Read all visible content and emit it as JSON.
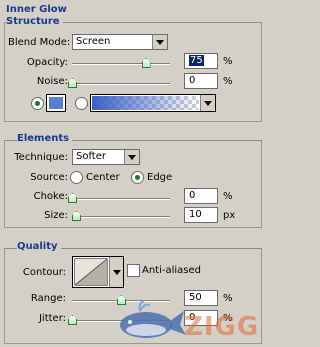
{
  "panel_title": "Inner Glow",
  "structure": {
    "title": "Structure",
    "blend_mode_label": "Blend Mode:",
    "blend_mode_value": "Screen",
    "opacity_label": "Opacity:",
    "opacity_value": "75",
    "opacity_unit": "%",
    "opacity_level": 0.75,
    "noise_label": "Noise:",
    "noise_value": "0",
    "noise_unit": "%",
    "noise_level": 0.0,
    "color_swatch": "#5b7fd0",
    "gradient_from": "#3a5fc8",
    "gradient_to": "#ffffff"
  },
  "elements": {
    "title": "Elements",
    "technique_label": "Technique:",
    "technique_value": "Softer",
    "source_label": "Source:",
    "source_center": "Center",
    "source_edge": "Edge",
    "choke_label": "Choke:",
    "choke_value": "0",
    "choke_unit": "%",
    "choke_level": 0.0,
    "size_label": "Size:",
    "size_value": "10",
    "size_unit": "px",
    "size_level": 0.04
  },
  "quality": {
    "title": "Quality",
    "contour_label": "Contour:",
    "antialiased_label": "Anti-aliased",
    "range_label": "Range:",
    "range_value": "50",
    "range_unit": "%",
    "range_level": 0.5,
    "jitter_label": "Jitter:",
    "jitter_value": "0",
    "jitter_unit": "%",
    "jitter_level": 0.0
  },
  "watermark": {
    "text": "ZIGG"
  }
}
